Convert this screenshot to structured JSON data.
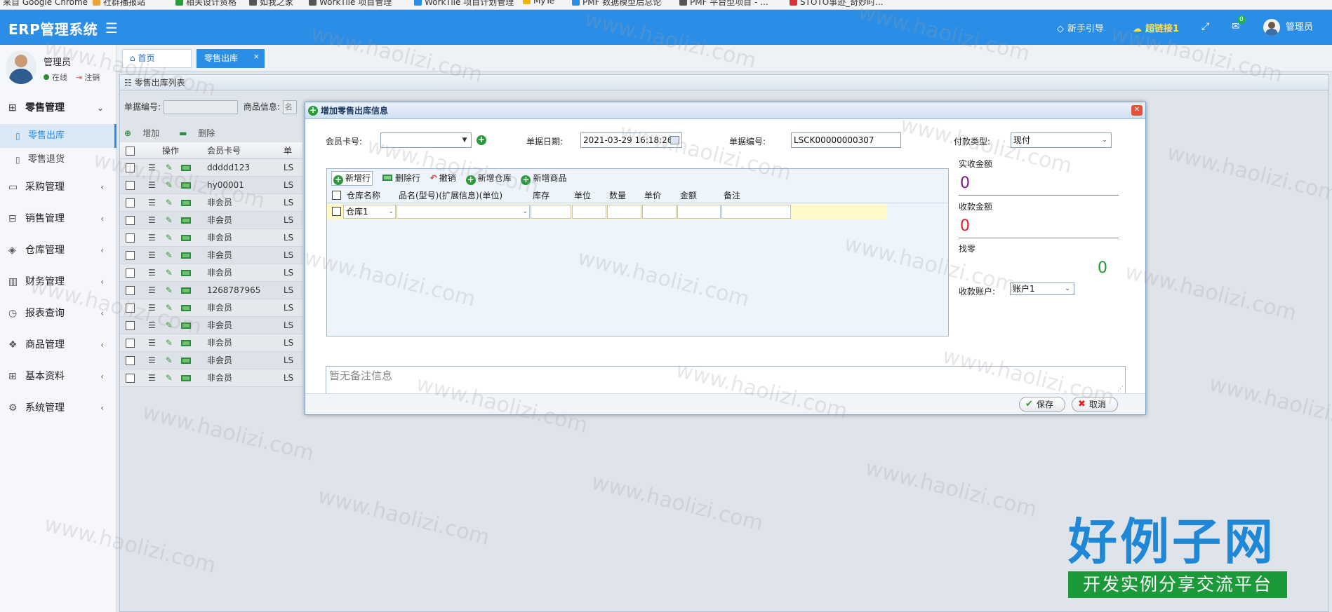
{
  "bookmarks": [
    "来自 Google Chrome",
    "社群播报站",
    "相关设计资格",
    "如我之家",
    "WorkTile 项目管理",
    "WorkTile 项目计划管理",
    "MyTe",
    "PMF 数据模型后总论",
    "PMF 平台型项目 - ...",
    "STOTO事迹_奇妙时..."
  ],
  "topbar": {
    "brand": "ERP管理系统",
    "menu_icon": "☰",
    "guide": "新手引导",
    "super_link": "超链接1",
    "msg_count": "0",
    "user": "管理员"
  },
  "user": {
    "name": "管理员",
    "status": "在线",
    "logout": "注销"
  },
  "nav": [
    {
      "label": "零售管理",
      "icon": "gift-icon",
      "open": true,
      "children": [
        "零售出库",
        "零售退货"
      ]
    },
    {
      "label": "采购管理",
      "icon": "desktop-icon"
    },
    {
      "label": "销售管理",
      "icon": "briefcase-icon"
    },
    {
      "label": "仓库管理",
      "icon": "layers-icon"
    },
    {
      "label": "财务管理",
      "icon": "book-icon"
    },
    {
      "label": "报表查询",
      "icon": "clock-icon"
    },
    {
      "label": "商品管理",
      "icon": "cubes-icon"
    },
    {
      "label": "基本资料",
      "icon": "grid-icon"
    },
    {
      "label": "系统管理",
      "icon": "gear-icon"
    }
  ],
  "tabs": {
    "home": "首页",
    "active": "零售出库",
    "close": "×"
  },
  "list": {
    "title": "零售出库列表",
    "search_bill_label": "单据编号:",
    "search_goods_label": "商品信息:",
    "search_goods_placeholder": "名",
    "add": "增加",
    "delete": "删除",
    "col_ops": "操作",
    "col_member": "会员卡号",
    "col_doc": "单",
    "rows": [
      {
        "member": "ddddd123",
        "doc": "LS"
      },
      {
        "member": "hy00001",
        "doc": "LS"
      },
      {
        "member": "非会员",
        "doc": "LS"
      },
      {
        "member": "非会员",
        "doc": "LS"
      },
      {
        "member": "非会员",
        "doc": "LS"
      },
      {
        "member": "非会员",
        "doc": "LS"
      },
      {
        "member": "非会员",
        "doc": "LS"
      },
      {
        "member": "1268787965",
        "doc": "LS"
      },
      {
        "member": "非会员",
        "doc": "LS"
      },
      {
        "member": "非会员",
        "doc": "LS"
      },
      {
        "member": "非会员",
        "doc": "LS"
      },
      {
        "member": "非会员",
        "doc": "LS"
      },
      {
        "member": "非会员",
        "doc": "LS"
      }
    ]
  },
  "modal": {
    "title": "增加零售出库信息",
    "member_label": "会员卡号:",
    "member_value": "",
    "date_label": "单据日期:",
    "date_value": "2021-03-29 16:18:26",
    "bill_label": "单据编号:",
    "bill_value": "LSCK00000000307",
    "pay_label": "付款类型:",
    "pay_value": "现付",
    "tool_add_row": "新增行",
    "tool_del_row": "删除行",
    "tool_undo": "撤销",
    "tool_add_wh": "新增仓库",
    "tool_add_goods": "新增商品",
    "col_wh": "仓库名称",
    "col_name": "品名(型号)(扩展信息)(单位)",
    "col_stock": "库存",
    "col_unit": "单位",
    "col_qty": "数量",
    "col_price": "单价",
    "col_amount": "金额",
    "col_note": "备注",
    "row_wh": "仓库1",
    "received_label": "实收金额",
    "received_value": "0",
    "collected_label": "收款金额",
    "collected_value": "0",
    "change_label": "找零",
    "change_value": "0",
    "account_label": "收款账户:",
    "account_value": "账户1",
    "remarks_placeholder": "暂无备注信息",
    "save": "保存",
    "cancel": "取消",
    "colors": {
      "received": "#7a1a8c",
      "collected": "#e02020",
      "change": "#1f9a2f"
    }
  },
  "watermark": "www.haolizi.com",
  "brandmark": {
    "title": "好例子网",
    "slogan": "开发实例分享交流平台"
  }
}
